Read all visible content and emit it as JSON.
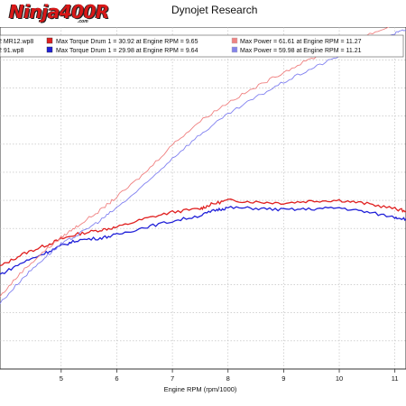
{
  "header": {
    "logo_text": "Ninja400R",
    "logo_sub": ".com"
  },
  "chart_data": {
    "type": "line",
    "title": "Dynojet Research",
    "xlabel": "Engine RPM (rpm/1000)",
    "ylabel": "",
    "xlim": [
      3.9,
      11.2
    ],
    "ylim": [
      0,
      100
    ],
    "xticks": [
      5,
      6,
      7,
      8,
      9,
      10,
      11
    ],
    "grid": true,
    "legend_position": "top",
    "legend": [
      {
        "file": "2 MR12.wp8",
        "torque_label": "Max Torque Drum 1 = 30.92 at Engine RPM = 9.65",
        "power_label": "Max Power = 61.61 at Engine RPM = 11.27",
        "color": "#e02020"
      },
      {
        "file": "2 91.wp8",
        "torque_label": "Max Torque Drum 1 = 29.98 at Engine RPM = 9.64",
        "power_label": "Max Power = 59.98 at Engine RPM = 11.21",
        "color": "#2020d8"
      }
    ],
    "series": [
      {
        "color": "#e02020",
        "style": "solid",
        "x": [
          3.9,
          4.3,
          4.7,
          5.0,
          5.3,
          5.7,
          6.0,
          6.5,
          7.0,
          7.5,
          7.7,
          8.0,
          8.5,
          9.0,
          9.5,
          10.0,
          10.5,
          11.0,
          11.2
        ],
        "y": [
          30.4,
          34.0,
          36.5,
          38.5,
          40.0,
          41.2,
          42.0,
          44.5,
          46.5,
          47.5,
          48.8,
          50.0,
          49.5,
          49.2,
          49.8,
          50.0,
          49.0,
          47.5,
          46.8
        ]
      },
      {
        "color": "#2020d8",
        "style": "solid",
        "x": [
          3.9,
          4.3,
          4.7,
          5.0,
          5.3,
          5.7,
          6.0,
          6.5,
          7.0,
          7.5,
          7.8,
          8.0,
          8.5,
          9.0,
          9.5,
          10.0,
          10.5,
          11.0,
          11.2
        ],
        "y": [
          28.0,
          31.5,
          34.3,
          36.5,
          38.2,
          38.8,
          39.8,
          42.0,
          43.8,
          45.5,
          47.2,
          47.8,
          47.6,
          47.2,
          47.4,
          47.8,
          46.5,
          45.0,
          44.5
        ]
      },
      {
        "color": "#f08080",
        "style": "faint",
        "x": [
          3.9,
          4.3,
          4.7,
          5.0,
          5.3,
          5.7,
          6.0,
          6.5,
          7.0,
          7.5,
          8.0,
          8.5,
          9.0,
          9.5,
          10.0,
          10.5,
          11.0,
          11.2
        ],
        "y": [
          21.5,
          29.0,
          35.0,
          39.0,
          42.5,
          47.0,
          51.0,
          58.0,
          66.5,
          73.5,
          79.0,
          83.5,
          88.0,
          92.0,
          95.5,
          99.0,
          102.0,
          103.0
        ]
      },
      {
        "color": "#8080f0",
        "style": "faint",
        "x": [
          3.9,
          4.3,
          4.7,
          5.0,
          5.3,
          5.7,
          6.0,
          6.5,
          7.0,
          7.5,
          8.0,
          8.5,
          9.0,
          9.5,
          10.0,
          10.5,
          11.0,
          11.2
        ],
        "y": [
          19.5,
          26.8,
          33.0,
          37.0,
          39.8,
          44.0,
          47.8,
          54.5,
          62.5,
          69.5,
          75.5,
          80.5,
          85.0,
          89.0,
          92.8,
          96.5,
          99.5,
          100.5
        ]
      }
    ]
  }
}
